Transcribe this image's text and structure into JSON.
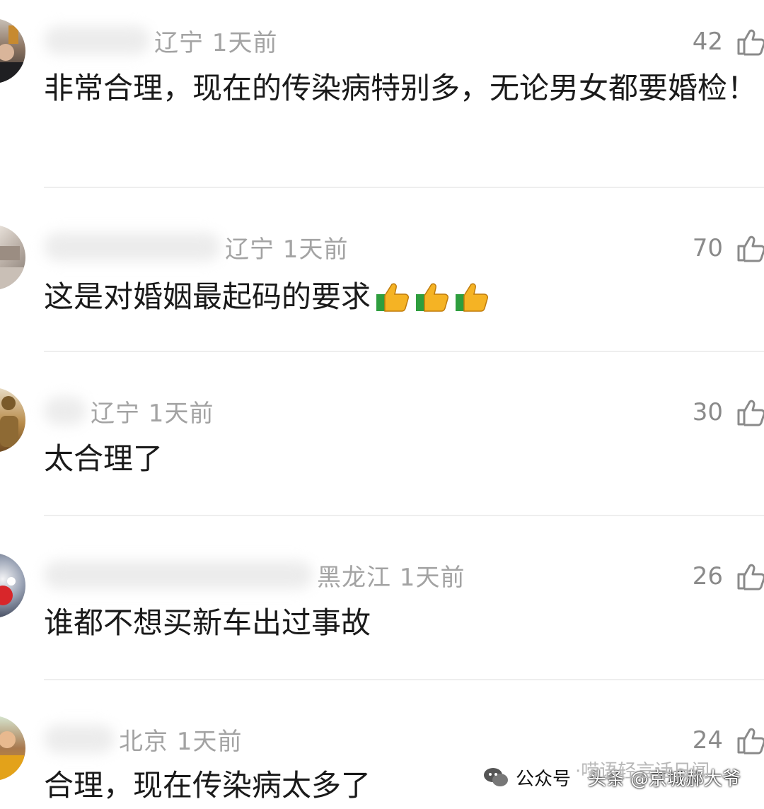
{
  "comments": [
    {
      "region_time": "辽宁 1天前",
      "likes": "42",
      "text": "非常合理，现在的传染病特别多，无论男女都要婚检！"
    },
    {
      "region_time": "辽宁 1天前",
      "likes": "70",
      "text": "这是对婚姻最起码的要求"
    },
    {
      "region_time": "辽宁 1天前",
      "likes": "30",
      "text": "太合理了"
    },
    {
      "region_time": "黑龙江 1天前",
      "likes": "26",
      "text": "谁都不想买新车出过事故"
    },
    {
      "region_time": "北京 1天前",
      "likes": "24",
      "text": "合理，现在传染病太多了"
    }
  ],
  "watermark": {
    "platform": "公众号",
    "account_faded": "·唠语轻言话日闻",
    "prefix": "头条",
    "account": "@京城郝大爷"
  },
  "icons": [
    "avatar",
    "thumbs-up-outline-icon",
    "thumbs-up-emoji-icon",
    "wechat-icon"
  ]
}
